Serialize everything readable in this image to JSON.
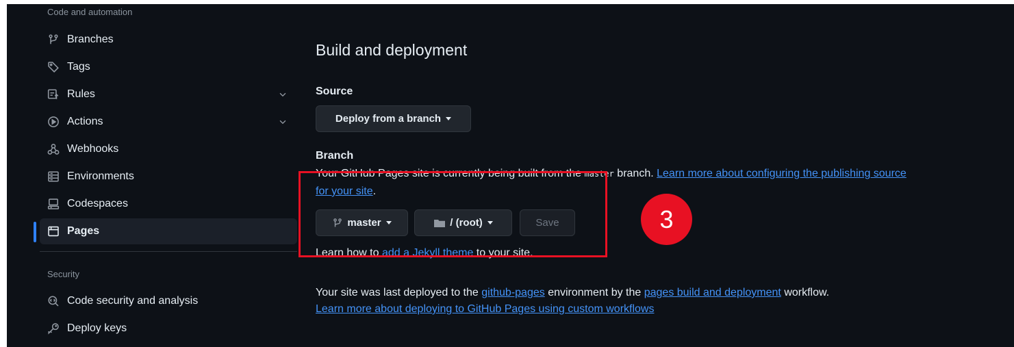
{
  "sidebar": {
    "section_code": "Code and automation",
    "section_security": "Security",
    "items": [
      {
        "label": "Branches",
        "icon": "branch-icon"
      },
      {
        "label": "Tags",
        "icon": "tag-icon"
      },
      {
        "label": "Rules",
        "icon": "rules-icon",
        "expandable": true
      },
      {
        "label": "Actions",
        "icon": "play-icon",
        "expandable": true
      },
      {
        "label": "Webhooks",
        "icon": "webhook-icon"
      },
      {
        "label": "Environments",
        "icon": "server-icon"
      },
      {
        "label": "Codespaces",
        "icon": "codespaces-icon"
      },
      {
        "label": "Pages",
        "icon": "browser-icon",
        "active": true
      }
    ],
    "security_items": [
      {
        "label": "Code security and analysis",
        "icon": "codescan-icon"
      },
      {
        "label": "Deploy keys",
        "icon": "key-icon"
      }
    ]
  },
  "main": {
    "title": "Build and deployment",
    "source_label": "Source",
    "source_select": "Deploy from a branch",
    "branch_label": "Branch",
    "branch_desc_1": "Your GitHub Pages site is currently being built from the ",
    "branch_desc_code": "master",
    "branch_desc_2": " branch. ",
    "branch_link_1": "Learn more about configuring the publishing source",
    "branch_link_2": "for your site",
    "branch_desc_end": ".",
    "branch_button": "master",
    "folder_button": "/ (root)",
    "save_button": "Save",
    "jekyll_1": "Learn how to ",
    "jekyll_link": "add a Jekyll theme",
    "jekyll_2": " to your site.",
    "deploy_1": "Your site was last deployed to the ",
    "deploy_env_link": "github-pages",
    "deploy_2": " environment by the ",
    "deploy_workflow_link": "pages build and deployment",
    "deploy_3": " workflow.",
    "custom_workflows_link": "Learn more about deploying to GitHub Pages using custom workflows"
  },
  "annotation": {
    "step_number": "3",
    "color": "#e81123"
  },
  "colors": {
    "background": "#0d1117",
    "link": "#4493f8",
    "accent": "#2f81f7"
  }
}
